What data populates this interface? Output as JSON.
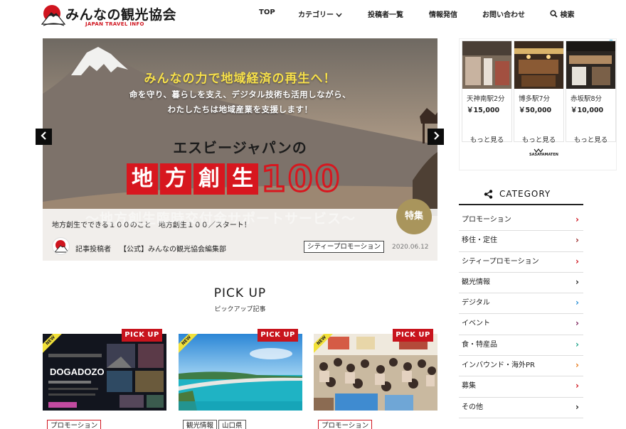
{
  "header": {
    "logo_title": "みんなの観光協会",
    "logo_sub": "JAPAN TRAVEL INFO",
    "nav": [
      {
        "label": "TOP"
      },
      {
        "label": "カテゴリー"
      },
      {
        "label": "投稿者一覧"
      },
      {
        "label": "情報発信"
      },
      {
        "label": "お問い合わせ"
      },
      {
        "label": "検索"
      }
    ]
  },
  "slider": {
    "headline": "みんなの力で地域経済の再生へ！",
    "sub1": "命を守り、暮らしを支え、デジタル技術も活用しながら、",
    "sub2": "わたしたちは地域産業を支援します！",
    "company": "エスビージャパンの",
    "kanji": [
      "地",
      "方",
      "創",
      "生"
    ],
    "number": "100",
    "ghost_text": "〜地方創生臨時交付金サポートサービス〜",
    "feature_badge": "特集",
    "caption_title": "地方創生でできる１００のこと　地方創生１００／スタート！",
    "author_label": "記事投稿者",
    "author_name": "【公式】みんなの観光協会編集部",
    "tag": "シティープロモーション",
    "date": "2020.06.12"
  },
  "pickup": {
    "title": "PICK UP",
    "subtitle": "ピックアップ記事",
    "new_label": "NEW",
    "pickup_label": "PICK UP",
    "cards": [
      {
        "tags": [
          "プロモーション"
        ],
        "image_text": "DOGADOZO"
      },
      {
        "tags": [
          "観光情報",
          "山口県"
        ]
      },
      {
        "tags": [
          "プロモーション"
        ]
      }
    ]
  },
  "ad": {
    "items": [
      {
        "place": "天神南駅2分",
        "price": "￥15,000",
        "more": "もっと見る"
      },
      {
        "place": "博多駅7分",
        "price": "￥50,000",
        "more": "もっと見る"
      },
      {
        "place": "赤坂駅8分",
        "price": "￥10,000",
        "more": "もっと見る"
      }
    ],
    "logo": "SASAYAMATEN"
  },
  "category": {
    "title": "CATEGORY",
    "items": [
      {
        "label": "プロモーション",
        "color": "#d0151f"
      },
      {
        "label": "移住・定住",
        "color": "#9b2c2c"
      },
      {
        "label": "シティープロモーション",
        "color": "#d0151f"
      },
      {
        "label": "観光情報",
        "color": "#222222"
      },
      {
        "label": "デジタル",
        "color": "#2a8fd6"
      },
      {
        "label": "イベント",
        "color": "#7a1f5a"
      },
      {
        "label": "食・特産品",
        "color": "#1fa38a"
      },
      {
        "label": "インバウンド・海外PR",
        "color": "#e87a1a"
      },
      {
        "label": "募集",
        "color": "#d0151f"
      },
      {
        "label": "その他",
        "color": "#222222"
      }
    ]
  }
}
